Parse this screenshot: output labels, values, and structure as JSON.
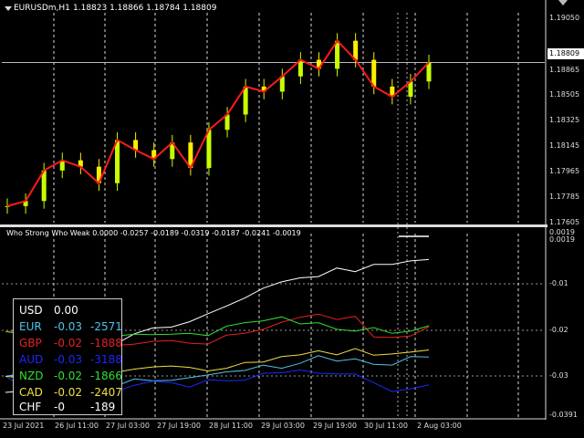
{
  "header": {
    "symbol": "EURUSDm,H1",
    "ohlc": "1.18823 1.18866 1.18784 1.18809"
  },
  "indicator": {
    "label": "Who Strong Who Weak 0.0000 -0.0257 -0.0189 -0.0319 -0.0187 -0.0241 -0.0019"
  },
  "price_axis": {
    "ticks": [
      "1.19050",
      "1.18865",
      "1.18505",
      "1.18325",
      "1.18145",
      "1.17965",
      "1.17785",
      "1.17605"
    ],
    "current": "1.18809"
  },
  "indicator_axis": {
    "ticks": [
      "0.0019",
      "0.0019",
      "-0.01",
      "-0.02",
      "-0.03",
      "-0.0391"
    ]
  },
  "time_axis": {
    "ticks": [
      "23 Jul 2021",
      "26 Jul 11:00",
      "27 Jul 03:00",
      "27 Jul 19:00",
      "28 Jul 11:00",
      "29 Jul 03:00",
      "29 Jul 19:00",
      "30 Jul 11:00",
      "2 Aug 03:00"
    ]
  },
  "table": {
    "rows": [
      {
        "currency": "USD",
        "value": "0.00",
        "points": "",
        "color": "#ffffff"
      },
      {
        "currency": "EUR",
        "value": "-0.03",
        "points": "-2571",
        "color": "#4fc3e8"
      },
      {
        "currency": "GBP",
        "value": "-0.02",
        "points": "-1888",
        "color": "#e82020"
      },
      {
        "currency": "AUD",
        "value": "-0.03",
        "points": "-3188",
        "color": "#1c28ff"
      },
      {
        "currency": "NZD",
        "value": "-0.02",
        "points": "-1866",
        "color": "#2fe02f"
      },
      {
        "currency": "CAD",
        "value": "-0.02",
        "points": "-2407",
        "color": "#f0e040"
      },
      {
        "currency": "CHF",
        "value": "-0",
        "points": "-189",
        "color": "#ffffff"
      }
    ]
  },
  "colors": {
    "background": "#000000",
    "price_line": "#ff1a1a",
    "bull_candle": "#c8ff00",
    "bear_candle": "#ffee00",
    "grid": "#ffffff"
  },
  "chart_data": {
    "type": "line",
    "title": "EURUSDm,H1",
    "series": [
      {
        "name": "EURUSDm",
        "values": [
          1.1768,
          1.1772,
          1.1796,
          1.1804,
          1.1799,
          1.1786,
          1.182,
          1.1812,
          1.1805,
          1.1818,
          1.1798,
          1.1828,
          1.184,
          1.1862,
          1.1858,
          1.187,
          1.1883,
          1.1876,
          1.1898,
          1.1883,
          1.1862,
          1.1854,
          1.1866,
          1.1881
        ]
      }
    ],
    "indicator_series": [
      {
        "name": "USD",
        "values": [
          -0.0336,
          -0.0333,
          -0.0328,
          -0.0318,
          -0.03,
          -0.0262,
          -0.0228,
          -0.0205,
          -0.0192,
          -0.019,
          -0.0178,
          -0.016,
          -0.0143,
          -0.0125,
          -0.0103,
          -0.0089,
          -0.008,
          -0.0077,
          -0.0058,
          -0.0066,
          -0.005,
          -0.005,
          -0.0042,
          -0.0039
        ]
      },
      {
        "name": "EUR",
        "values": [
          -0.03,
          -0.0293,
          -0.0306,
          -0.0305,
          -0.0306,
          -0.0315,
          -0.0322,
          -0.0306,
          -0.031,
          -0.0309,
          -0.0303,
          -0.0297,
          -0.029,
          -0.0287,
          -0.0275,
          -0.0282,
          -0.0271,
          -0.0254,
          -0.0266,
          -0.0261,
          -0.0273,
          -0.0275,
          -0.0256,
          -0.0257
        ]
      },
      {
        "name": "GBP",
        "values": [
          -0.02,
          -0.0198,
          -0.0202,
          -0.0205,
          -0.023,
          -0.0229,
          -0.0231,
          -0.0228,
          -0.0222,
          -0.022,
          -0.0226,
          -0.0228,
          -0.0208,
          -0.0204,
          -0.0195,
          -0.0179,
          -0.0168,
          -0.0161,
          -0.0173,
          -0.0166,
          -0.0212,
          -0.0213,
          -0.021,
          -0.0189
        ]
      },
      {
        "name": "AUD",
        "values": [
          -0.03,
          -0.0325,
          -0.0323,
          -0.0322,
          -0.0304,
          -0.0314,
          -0.0334,
          -0.032,
          -0.0311,
          -0.0314,
          -0.0324,
          -0.0308,
          -0.031,
          -0.0309,
          -0.0293,
          -0.0292,
          -0.0286,
          -0.0293,
          -0.0295,
          -0.0295,
          -0.0314,
          -0.0334,
          -0.0328,
          -0.0319
        ]
      },
      {
        "name": "NZD",
        "values": [
          -0.02,
          -0.0206,
          -0.0207,
          -0.0207,
          -0.0208,
          -0.0212,
          -0.021,
          -0.0206,
          -0.0207,
          -0.0206,
          -0.0204,
          -0.0209,
          -0.0188,
          -0.018,
          -0.0176,
          -0.0167,
          -0.0183,
          -0.018,
          -0.0195,
          -0.0199,
          -0.0191,
          -0.0204,
          -0.0199,
          -0.0187
        ]
      },
      {
        "name": "CAD",
        "values": [
          -0.03,
          -0.0304,
          -0.0305,
          -0.0299,
          -0.0298,
          -0.0304,
          -0.0291,
          -0.0284,
          -0.0279,
          -0.0277,
          -0.028,
          -0.0288,
          -0.0282,
          -0.0269,
          -0.0268,
          -0.0256,
          -0.0252,
          -0.0243,
          -0.0252,
          -0.0238,
          -0.0253,
          -0.025,
          -0.0246,
          -0.0241
        ]
      }
    ],
    "ylim": [
      1.1755,
      1.192
    ],
    "indicator_ylim": [
      -0.0391,
      0.0019
    ],
    "grid": true
  }
}
